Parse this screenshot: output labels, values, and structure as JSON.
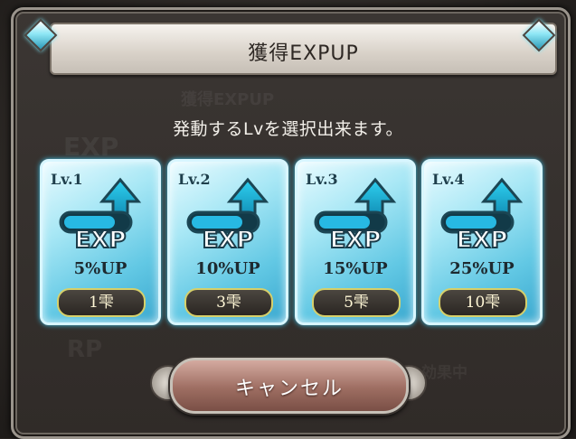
{
  "dialog": {
    "title": "獲得EXPUP",
    "instruction": "発動するLvを選択出来ます。",
    "background_ghost": {
      "title": "獲得EXPUP",
      "exp": "EXP",
      "rp": "RP",
      "status": "効果中"
    }
  },
  "cards": [
    {
      "level": "Lv.1",
      "icon_label": "EXP",
      "percent": "5%UP",
      "cost": "1雫"
    },
    {
      "level": "Lv.2",
      "icon_label": "EXP",
      "percent": "10%UP",
      "cost": "3雫"
    },
    {
      "level": "Lv.3",
      "icon_label": "EXP",
      "percent": "15%UP",
      "cost": "5雫"
    },
    {
      "level": "Lv.4",
      "icon_label": "EXP",
      "percent": "25%UP",
      "cost": "10雫"
    }
  ],
  "cancel_button": {
    "label": "キャンセル"
  },
  "colors": {
    "accent_cyan": "#62c8e4",
    "cost_border": "#d6d06a",
    "cancel": "#9e6e62"
  }
}
